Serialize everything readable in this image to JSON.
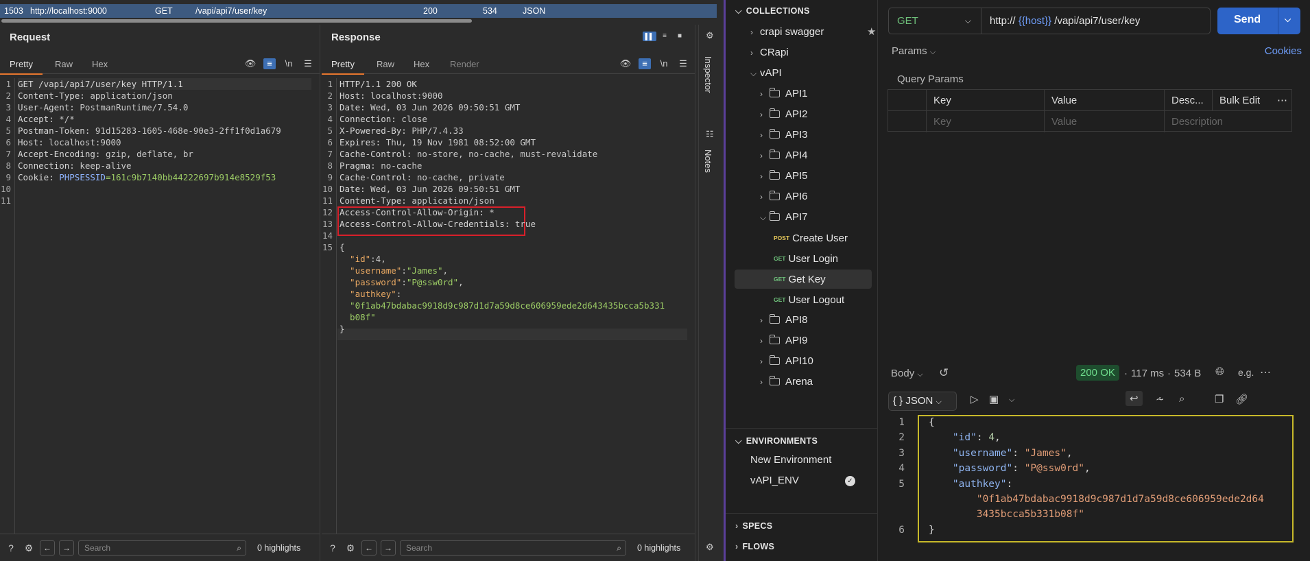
{
  "burp": {
    "history_row": {
      "num": "1503",
      "host": "http://localhost:9000",
      "method": "GET",
      "path": "/vapi/api7/user/key",
      "status": "200",
      "length": "534",
      "mime": "JSON"
    },
    "request": {
      "title": "Request",
      "tabs": [
        "Pretty",
        "Raw",
        "Hex"
      ],
      "line_numbers": [
        "1",
        "2",
        "3",
        "4",
        "5",
        "6",
        "7",
        "8",
        "9",
        "10",
        "11"
      ],
      "lines": [
        {
          "k": "GET /vapi/api7/user/key HTTP/1.1",
          "v": ""
        },
        {
          "k": "Content-Type: ",
          "v": "application/json"
        },
        {
          "k": "User-Agent: ",
          "v": "PostmanRuntime/7.54.0"
        },
        {
          "k": "Accept: ",
          "v": "*/*"
        },
        {
          "k": "Postman-Token: ",
          "v": "91d15283-1605-468e-90e3-2ff1f0d1a679"
        },
        {
          "k": "Host: ",
          "v": "localhost:9000"
        },
        {
          "k": "Accept-Encoding: ",
          "v": "gzip, deflate, br"
        },
        {
          "k": "Connection: ",
          "v": "keep-alive"
        },
        {
          "k": "Cookie: ",
          "v": "PHPSESSID",
          "v2": "=161c9b7140bb44222697b914e8529f53"
        },
        {
          "k": "",
          "v": ""
        },
        {
          "k": "",
          "v": ""
        }
      ]
    },
    "response": {
      "title": "Response",
      "tabs": [
        "Pretty",
        "Raw",
        "Hex",
        "Render"
      ],
      "line_numbers": [
        "1",
        "2",
        "3",
        "4",
        "5",
        "6",
        "7",
        "8",
        "9",
        "10",
        "11",
        "12",
        "13",
        "14",
        "15",
        "",
        "",
        "",
        "",
        "",
        "",
        "",
        ""
      ],
      "lines": [
        {
          "k": "HTTP/1.1 200 OK",
          "v": ""
        },
        {
          "k": "Host: ",
          "v": "localhost:9000"
        },
        {
          "k": "Date: ",
          "v": "Wed, 03 Jun 2026 09:50:51 GMT"
        },
        {
          "k": "Connection: ",
          "v": "close"
        },
        {
          "k": "X-Powered-By: ",
          "v": "PHP/7.4.33"
        },
        {
          "k": "Expires: ",
          "v": "Thu, 19 Nov 1981 08:52:00 GMT"
        },
        {
          "k": "Cache-Control: ",
          "v": "no-store, no-cache, must-revalidate"
        },
        {
          "k": "Pragma: ",
          "v": "no-cache"
        },
        {
          "k": "Cache-Control: ",
          "v": "no-cache, private"
        },
        {
          "k": "Date: ",
          "v": "Wed, 03 Jun 2026 09:50:51 GMT"
        },
        {
          "k": "Content-Type: ",
          "v": "application/json"
        },
        {
          "k": "Access-Control-Allow-Origin: ",
          "v": "*"
        },
        {
          "k": "Access-Control-Allow-Credentials: ",
          "v": "true"
        },
        {
          "k": "",
          "v": ""
        },
        {
          "k": "{",
          "v": ""
        },
        {
          "j": "  \"id\"",
          "jv": ":4,"
        },
        {
          "j": "  \"username\"",
          "jv": ":",
          "js": "\"James\"",
          "je": ","
        },
        {
          "j": "  \"password\"",
          "jv": ":",
          "js": "\"P@ssw0rd\"",
          "je": ","
        },
        {
          "j": "  \"authkey\"",
          "jv": ":"
        },
        {
          "js": "  \"0f1ab47bdabac9918d9c987d1d7a59d8ce606959ede2d643435bcca5b331"
        },
        {
          "js": "  b08f\""
        },
        {
          "k": "}",
          "v": ""
        }
      ]
    },
    "bottom": {
      "search_placeholder": "Search",
      "highlights": "0 highlights"
    },
    "side": {
      "inspector": "Inspector",
      "notes": "Notes"
    }
  },
  "postman": {
    "collections_header": "COLLECTIONS",
    "tree": {
      "crapi_swagger": "crapi swagger",
      "crapi": "CRapi",
      "vapi": "vAPI",
      "folders_top": [
        "API1",
        "API2",
        "API3",
        "API4",
        "API5",
        "API6",
        "API7"
      ],
      "requests": [
        {
          "method": "POST",
          "name": "Create User"
        },
        {
          "method": "GET",
          "name": "User Login"
        },
        {
          "method": "GET",
          "name": "Get Key"
        },
        {
          "method": "GET",
          "name": "User Logout"
        }
      ],
      "folders_bottom": [
        "API8",
        "API9",
        "API10",
        "Arena"
      ]
    },
    "environments_header": "ENVIRONMENTS",
    "environments": [
      "New Environment",
      "vAPI_ENV"
    ],
    "specs": "SPECS",
    "flows": "FLOWS",
    "method": "GET",
    "url_prefix": "http://",
    "url_var": "{{host}}",
    "url_path": "/vapi/api7/user/key",
    "send": "Send",
    "params_tab": "Params",
    "cookies": "Cookies",
    "query_params": "Query Params",
    "table": {
      "headers": [
        "Key",
        "Value",
        "Desc...",
        "Bulk Edit"
      ],
      "placeholders": [
        "Key",
        "Value",
        "Description"
      ]
    },
    "response_bar": {
      "body": "Body",
      "status": "200 OK",
      "time": "117 ms",
      "size": "534 B"
    },
    "format": "JSON",
    "body_lines": [
      {
        "n": "1",
        "t": "{"
      },
      {
        "n": "2",
        "key": "\"id\"",
        "sep": ": ",
        "num": "4",
        "end": ","
      },
      {
        "n": "3",
        "key": "\"username\"",
        "sep": ": ",
        "str": "\"James\"",
        "end": ","
      },
      {
        "n": "4",
        "key": "\"password\"",
        "sep": ": ",
        "str": "\"P@ssw0rd\"",
        "end": ","
      },
      {
        "n": "5",
        "key": "\"authkey\"",
        "sep": ":"
      },
      {
        "n": "",
        "str": "\"0f1ab47bdabac9918d9c987d1d7a59d8ce606959ede2d64"
      },
      {
        "n": "",
        "str": "3435bcca5b331b08f\""
      },
      {
        "n": "6",
        "t": "}"
      }
    ]
  }
}
